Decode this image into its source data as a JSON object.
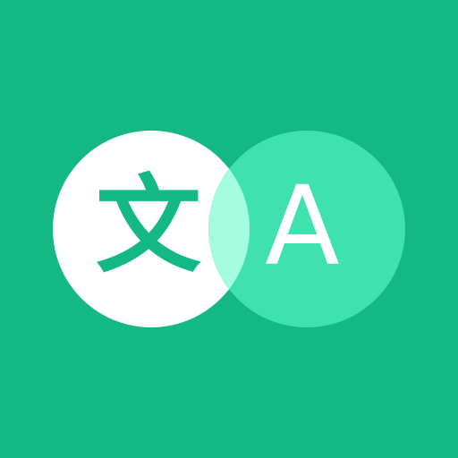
{
  "icon": {
    "name": "translate-app-icon",
    "source_glyph": "文",
    "target_glyph": "A",
    "colors": {
      "background": "#13b884",
      "left_circle": "#ffffff",
      "right_circle": "#3fe1ae",
      "overlap": "#a4fbde",
      "source_glyph": "#13b884",
      "target_glyph": "#ffffff"
    }
  }
}
